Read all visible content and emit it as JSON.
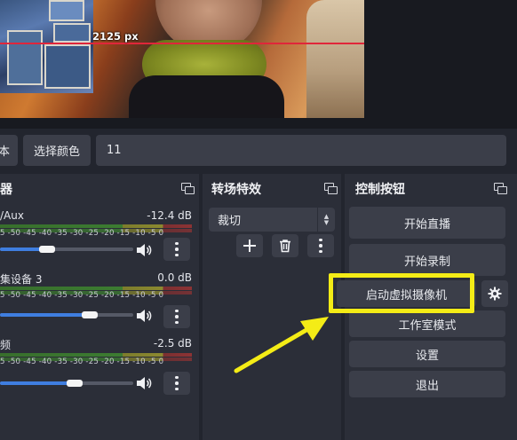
{
  "preview": {
    "guide_label": "2125 px"
  },
  "toolbar": {
    "left_partial_label": "本",
    "select_color_label": "选择颜色",
    "value_field": "11"
  },
  "mixer": {
    "title_partial": "器",
    "scale_ticks": "-55  -50  -45  -40  -35  -30  -25  -20  -15  -10  -5  0",
    "channels": [
      {
        "name": "/Aux",
        "db": "-12.4 dB",
        "volume": 0.35
      },
      {
        "name": "集设备 3",
        "db": "0.0 dB",
        "volume": 0.67
      },
      {
        "name": "频",
        "db": "-2.5 dB",
        "volume": 0.56
      }
    ]
  },
  "transitions": {
    "title": "转场特效",
    "selected": "裁切",
    "add_icon": "plus-icon",
    "remove_icon": "trash-icon",
    "menu_icon": "kebab-icon"
  },
  "controls": {
    "title": "控制按钮",
    "start_stream": "开始直播",
    "start_record": "开始录制",
    "start_virtual_cam": "启动虚拟摄像机",
    "studio_mode": "工作室模式",
    "settings": "设置",
    "exit": "退出",
    "gear_icon": "gear-icon"
  },
  "colors": {
    "background": "#22252e",
    "dock": "#2b2e38",
    "button": "#3b3e49",
    "accent_blue": "#3f7ee0",
    "annotation_yellow": "#f4ec16",
    "guide_red": "#e0263a"
  }
}
